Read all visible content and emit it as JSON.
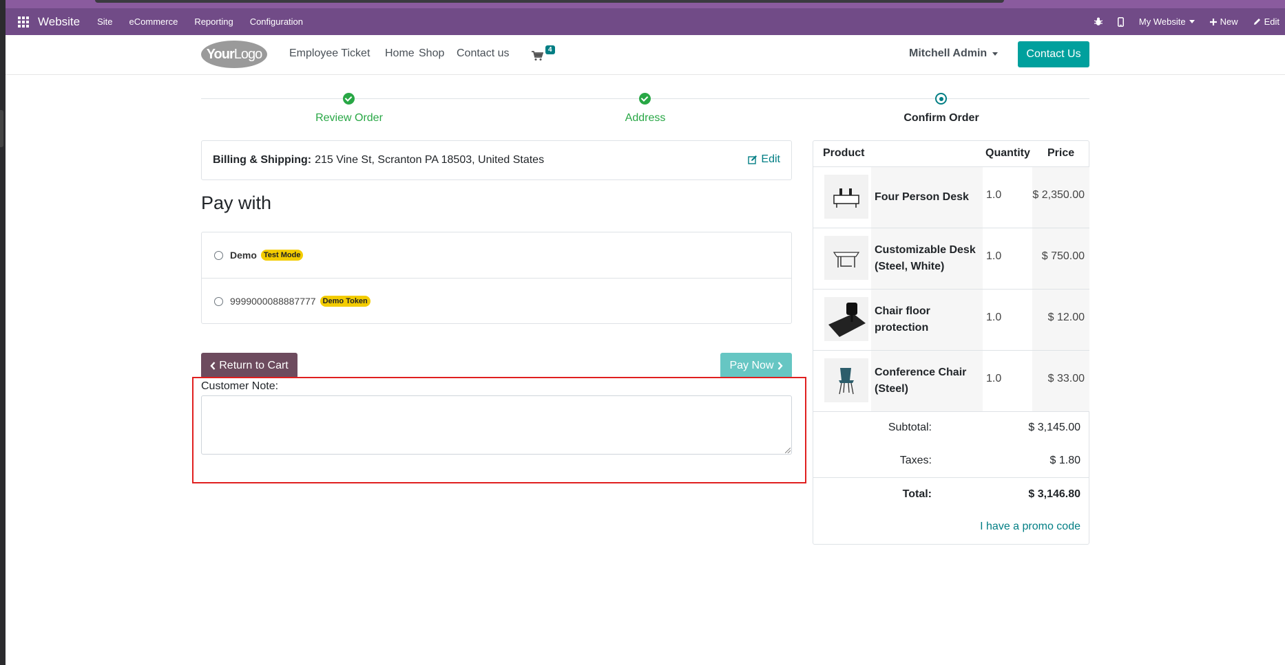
{
  "admin_bar": {
    "app_name": "Website",
    "menus": [
      "Site",
      "eCommerce",
      "Reporting",
      "Configuration"
    ],
    "right_items": {
      "website_selector": "My Website",
      "new_label": "New",
      "edit_label": "Edit"
    }
  },
  "site": {
    "logo_bold": "Your",
    "logo_light": "Logo",
    "nav": [
      "Employee Ticket",
      "Home",
      "Shop",
      "Contact us"
    ],
    "cart_count": "4",
    "user_name": "Mitchell Admin",
    "contact_button": "Contact Us"
  },
  "wizard": {
    "steps": [
      {
        "label": "Review Order",
        "state": "done"
      },
      {
        "label": "Address",
        "state": "done"
      },
      {
        "label": "Confirm Order",
        "state": "current"
      }
    ]
  },
  "billing": {
    "label": "Billing & Shipping:",
    "address": "215 Vine St, Scranton PA 18503, United States",
    "edit_label": "Edit"
  },
  "payment": {
    "title": "Pay with",
    "options": [
      {
        "name": "Demo",
        "badge": "Test Mode"
      },
      {
        "name": "9999000088887777",
        "badge": "Demo Token"
      }
    ]
  },
  "buttons": {
    "return_to_cart": "Return to Cart",
    "pay_now": "Pay Now"
  },
  "customer_note": {
    "label": "Customer Note:",
    "value": ""
  },
  "summary": {
    "headers": {
      "product": "Product",
      "quantity": "Quantity",
      "price": "Price"
    },
    "products": [
      {
        "name": "Four Person Desk",
        "qty": "1.0",
        "price": "$ 2,350.00"
      },
      {
        "name": "Customizable Desk (Steel, White)",
        "qty": "1.0",
        "price": "$ 750.00"
      },
      {
        "name": "Chair floor protection",
        "qty": "1.0",
        "price": "$ 12.00"
      },
      {
        "name": "Conference Chair (Steel)",
        "qty": "1.0",
        "price": "$ 33.00"
      }
    ],
    "subtotal_label": "Subtotal:",
    "subtotal": "$ 3,145.00",
    "taxes_label": "Taxes:",
    "taxes": "$ 1.80",
    "total_label": "Total:",
    "total": "$ 3,146.80",
    "promo_link": "I have a promo code"
  },
  "colors": {
    "admin_bar": "#714b87",
    "accent": "#017e84",
    "primary_button": "#00a09d",
    "success": "#28a745",
    "highlight": "#e01f1f"
  }
}
